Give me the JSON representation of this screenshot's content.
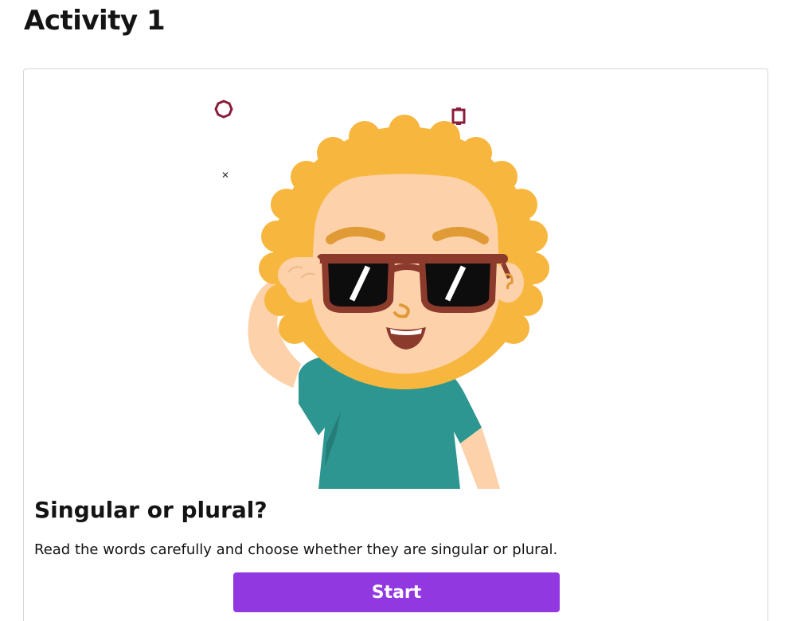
{
  "page": {
    "title": "Activity 1"
  },
  "activity": {
    "heading": "Singular or plural?",
    "description": "Read the words carefully and choose whether they are singular or plural.",
    "start_label": "Start"
  },
  "illustration": {
    "subject": "cartoon-child-with-sunglasses",
    "colors": {
      "hair": "#f7b63d",
      "skin": "#fdd2aa",
      "shirt": "#2e9690",
      "glasses_frame": "#8b3a2b",
      "lenses": "#0d0d0d",
      "confetti": "#8b1c3c",
      "button": "#9138e1"
    }
  }
}
